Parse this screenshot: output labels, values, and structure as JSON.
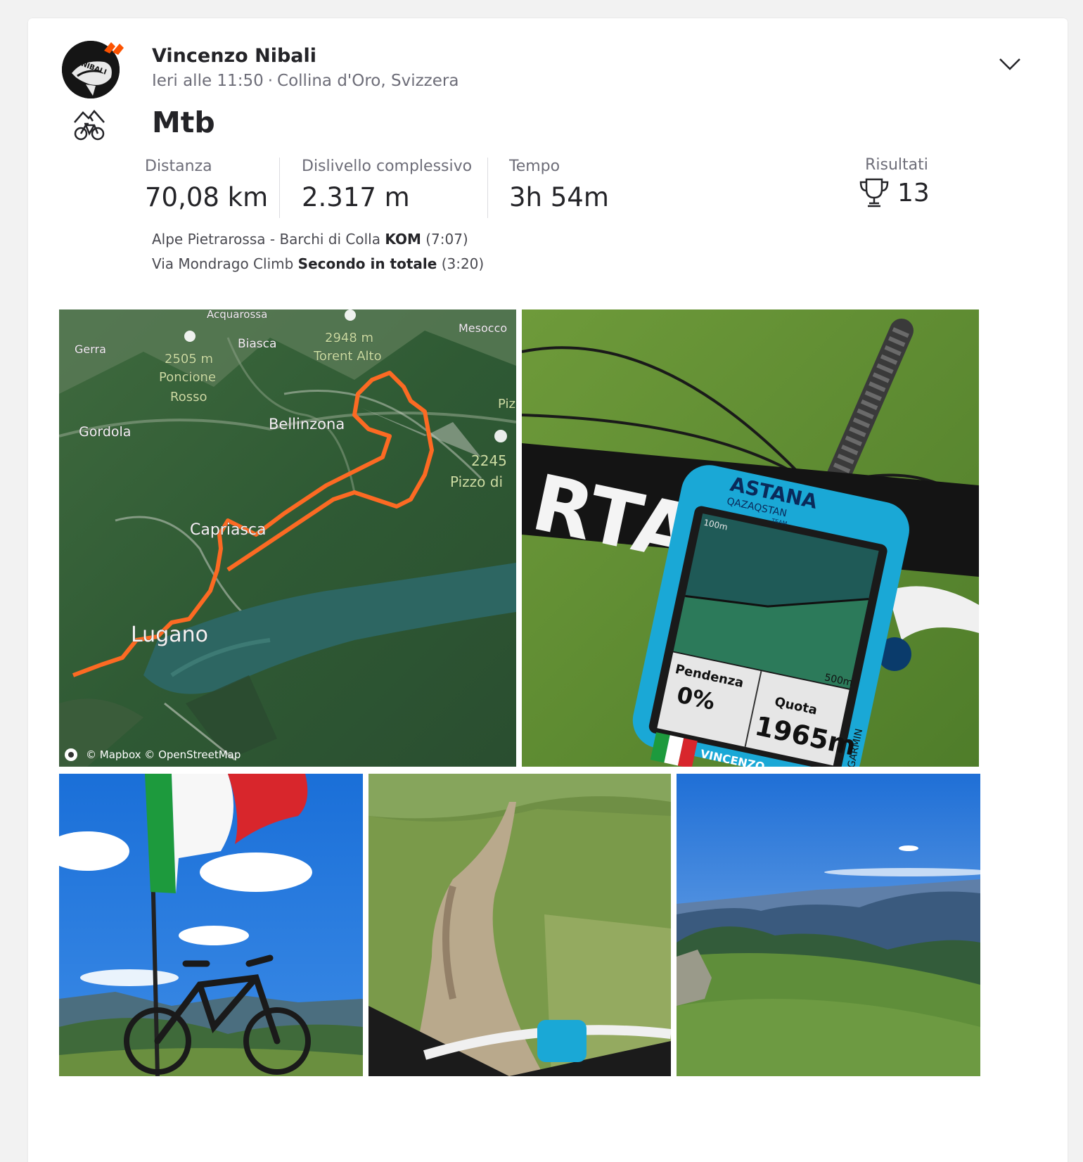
{
  "athlete": {
    "name": "Vincenzo Nibali",
    "date": "Ieri alle 11:50",
    "separator": "·",
    "location": "Collina d'Oro, Svizzera",
    "avatar_text": "NIBALI"
  },
  "activity": {
    "sport_icon": "mountain-bike-icon",
    "title": "Mtb",
    "stats": [
      {
        "label": "Distanza",
        "value": "70,08 km"
      },
      {
        "label": "Dislivello complessivo",
        "value": "2.317 m"
      },
      {
        "label": "Tempo",
        "value": "3h 54m"
      }
    ],
    "results": {
      "label": "Risultati",
      "value": "13",
      "icon": "trophy-icon"
    }
  },
  "segments": [
    {
      "name": "Alpe Pietrarossa - Barchi di Colla",
      "award": "KOM",
      "time": "(7:07)"
    },
    {
      "name": "Via Mondrago Climb",
      "award": "Secondo in totale",
      "time": "(3:20)"
    }
  ],
  "map": {
    "labels": [
      "Acquarossa",
      "Mesocco",
      "Gerra",
      "Biasca",
      "2948 m",
      "Torent Alto",
      "2505 m",
      "Poncione",
      "Rosso",
      "Gordola",
      "Bellinzona",
      "Piz",
      "2245",
      "Pizzo di",
      "Capriasca",
      "Lugano"
    ],
    "attribution": "© Mapbox © OpenStreetMap",
    "route_color": "#fc6a23"
  },
  "photos": {
    "gps_unit": {
      "brand": "ASTANA",
      "sub": "QAZAQSTAN",
      "team": "TEAM",
      "scale_top": "100m",
      "scale_bottom": "500m",
      "grade_label": "Pendenza",
      "grade_value": "0%",
      "altitude_label": "Quota",
      "altitude_value": "1965m",
      "maker": "GARMIN",
      "name": "VINCENZO"
    },
    "items": [
      "flag-bike-photo",
      "trail-photo",
      "valley-photo"
    ]
  },
  "colors": {
    "accent": "#fc5200",
    "text": "#242428",
    "muted": "#6d6d78"
  }
}
